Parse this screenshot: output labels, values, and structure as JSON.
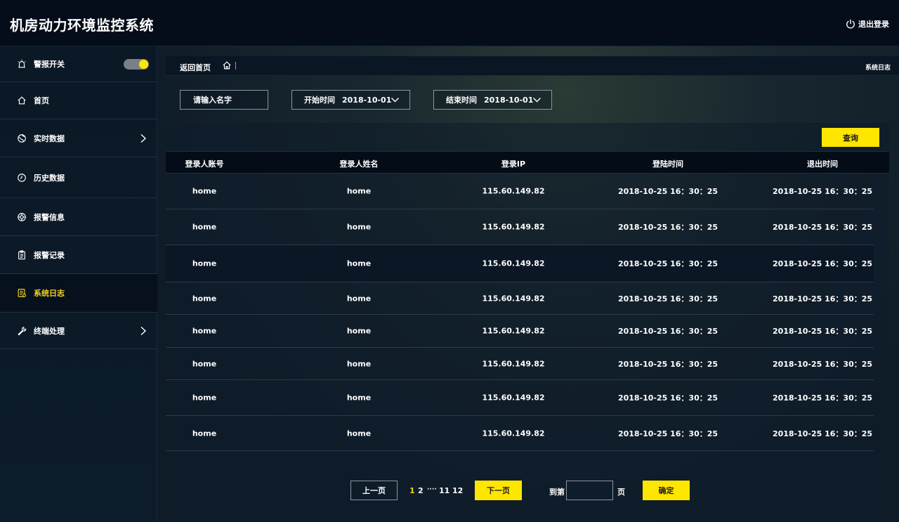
{
  "header": {
    "title": "机房动力环境监控系统",
    "logout_label": "退出登录"
  },
  "sidebar": {
    "alarm_switch": {
      "label": "警报开关",
      "on": true
    },
    "items": [
      {
        "label": "首页",
        "icon": "home-icon",
        "has_submenu": false,
        "active": false
      },
      {
        "label": "实时数据",
        "icon": "globe-icon",
        "has_submenu": true,
        "active": false
      },
      {
        "label": "历史数据",
        "icon": "clock-icon",
        "has_submenu": false,
        "active": false
      },
      {
        "label": "报警信息",
        "icon": "alarm-info-icon",
        "has_submenu": false,
        "active": false
      },
      {
        "label": "报警记录",
        "icon": "clipboard-icon",
        "has_submenu": false,
        "active": false
      },
      {
        "label": "系统日志",
        "icon": "log-icon",
        "has_submenu": false,
        "active": true
      },
      {
        "label": "终端处理",
        "icon": "wrench-icon",
        "has_submenu": true,
        "active": false
      }
    ]
  },
  "breadcrumb": {
    "back_label": "返回首页",
    "current": "系统日志"
  },
  "filters": {
    "name_placeholder": "请输入名字",
    "start_label": "开始时间",
    "start_value": "2018-10-01",
    "end_label": "结束时间",
    "end_value": "2018-10-01"
  },
  "query_label": "查询",
  "table": {
    "columns": [
      "登录人账号",
      "登录人姓名",
      "登录IP",
      "登陆时间",
      "退出时间"
    ],
    "rows": [
      [
        "home",
        "home",
        "115.60.149.82",
        "2018-10-25 16：30：25",
        "2018-10-25 16：30：25"
      ],
      [
        "home",
        "home",
        "115.60.149.82",
        "2018-10-25 16：30：25",
        "2018-10-25 16：30：25"
      ],
      [
        "home",
        "home",
        "115.60.149.82",
        "2018-10-25 16：30：25",
        "2018-10-25 16：30：25"
      ],
      [
        "home",
        "home",
        "115.60.149.82",
        "2018-10-25 16：30：25",
        "2018-10-25 16：30：25"
      ],
      [
        "home",
        "home",
        "115.60.149.82",
        "2018-10-25 16：30：25",
        "2018-10-25 16：30：25"
      ],
      [
        "home",
        "home",
        "115.60.149.82",
        "2018-10-25 16：30：25",
        "2018-10-25 16：30：25"
      ],
      [
        "home",
        "home",
        "115.60.149.82",
        "2018-10-25 16：30：25",
        "2018-10-25 16：30：25"
      ],
      [
        "home",
        "home",
        "115.60.149.82",
        "2018-10-25 16：30：25",
        "2018-10-25 16：30：25"
      ]
    ]
  },
  "pagination": {
    "prev_label": "上一页",
    "pages": [
      "1",
      "2",
      "····",
      "11",
      "12"
    ],
    "current_page": "1",
    "next_label": "下一页",
    "goto_label": "到第",
    "unit_label": "页",
    "confirm_label": "确定"
  },
  "colors": {
    "accent": "#ffe600",
    "header_bg": "#050c1a",
    "sidebar_bg": "#0b1825"
  }
}
